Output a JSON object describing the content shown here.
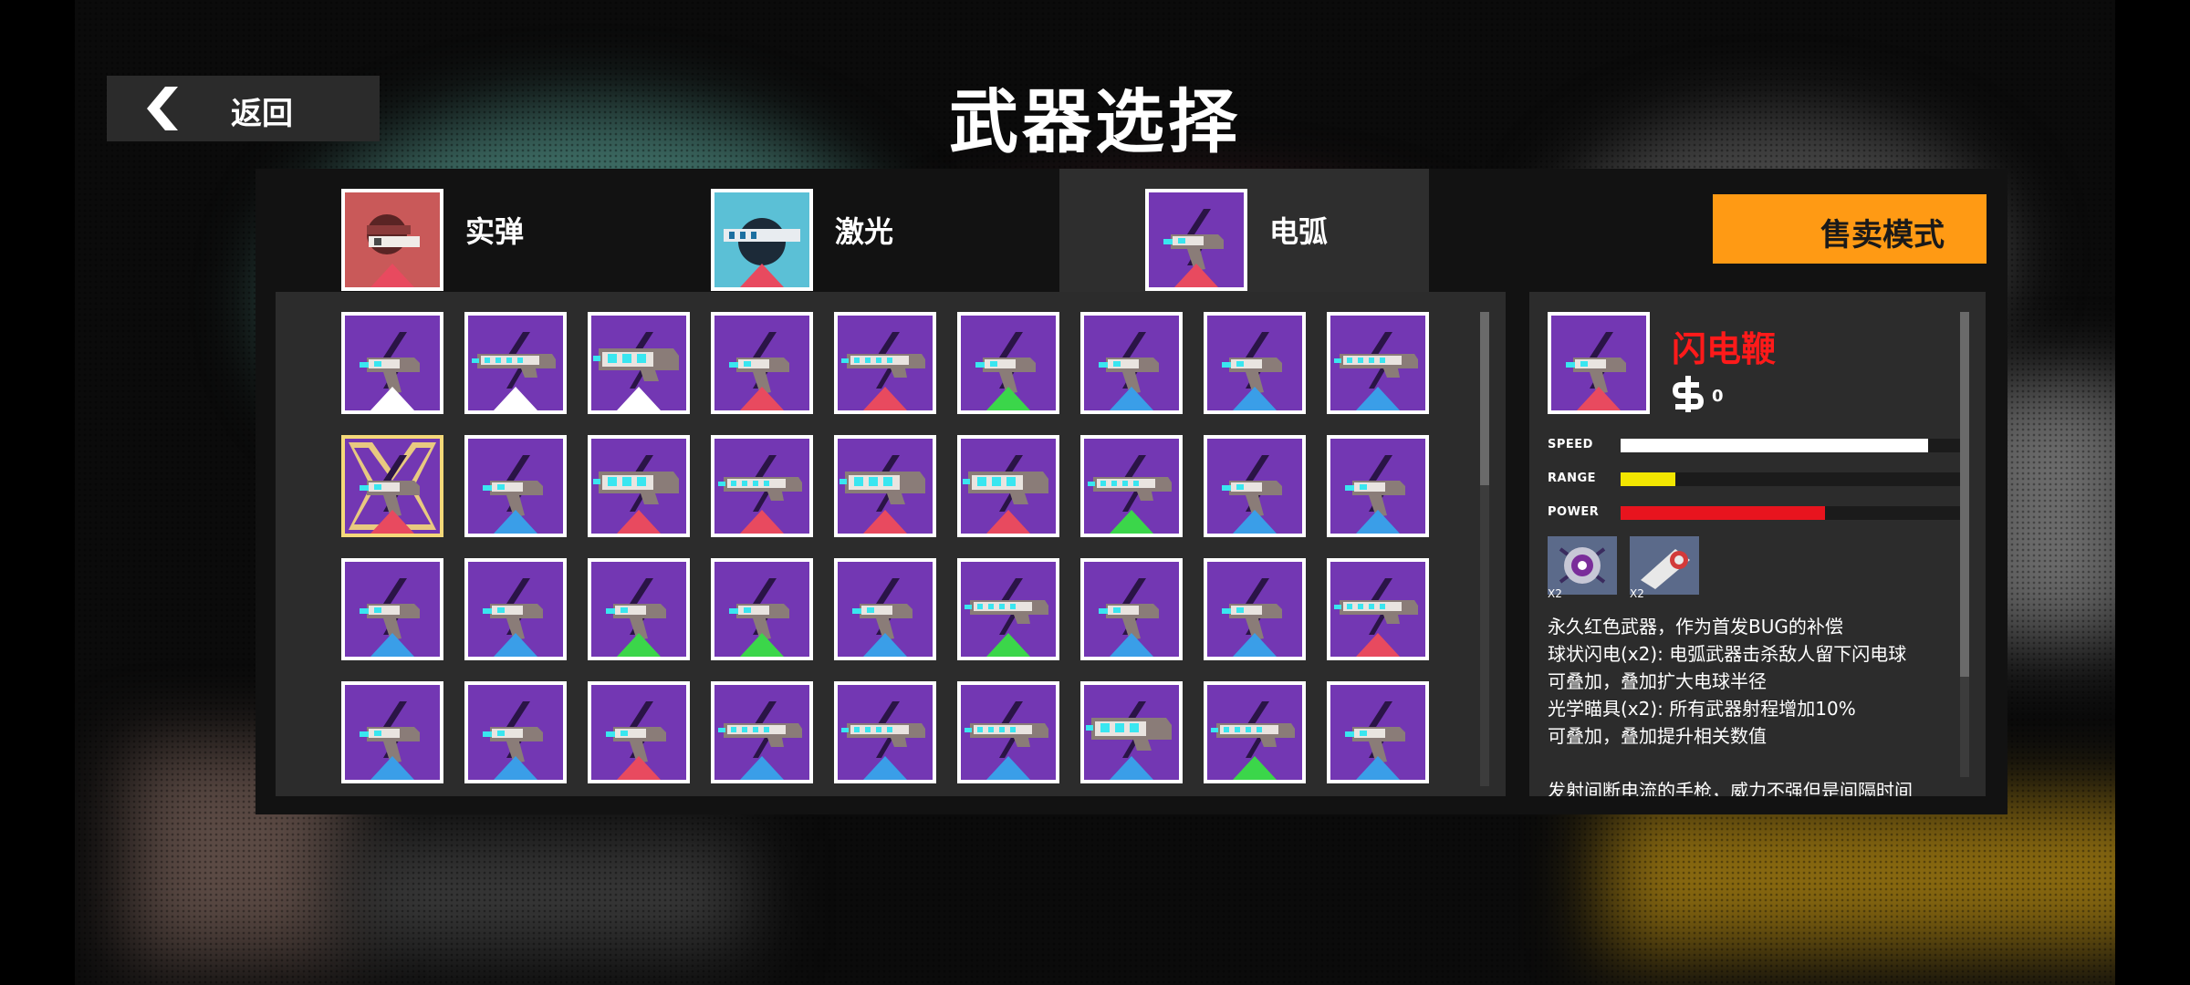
{
  "colors": {
    "tile_bg": "#7337b3",
    "tile_border": "#ffffff",
    "selected_border": "#f5d97a",
    "rarity_white": "#ffffff",
    "rarity_red": "#e84a5f",
    "rarity_green": "#3bd64a",
    "rarity_blue": "#3a9ee8",
    "sell_button": "#ff9a14",
    "name_red": "#ff1a1a",
    "speed_bar": "#ffffff",
    "range_bar": "#f2e600",
    "power_bar": "#e8141e"
  },
  "header": {
    "back_label": "返回",
    "back_icon": "chevron-left-icon",
    "title": "武器选择"
  },
  "tabs": [
    {
      "label": "实弹",
      "icon": "ballistic-gun-icon",
      "bg": "#c95959",
      "rarity": "red",
      "selected": false
    },
    {
      "label": "激光",
      "icon": "laser-gun-icon",
      "bg": "#5bc0d6",
      "rarity": "red",
      "selected": false
    },
    {
      "label": "电弧",
      "icon": "arc-gun-icon",
      "bg": "#7337b3",
      "rarity": "red",
      "selected": true
    }
  ],
  "sell_button": {
    "label": "售卖模式"
  },
  "weapons": [
    [
      {
        "k": "pistol",
        "r": "white"
      },
      {
        "k": "rifle",
        "r": "white"
      },
      {
        "k": "cannon",
        "r": "white"
      },
      {
        "k": "pistol",
        "r": "red"
      },
      {
        "k": "rifle",
        "r": "red"
      },
      {
        "k": "pistol",
        "r": "green"
      },
      {
        "k": "pistol",
        "r": "blue"
      },
      {
        "k": "pistol",
        "r": "blue"
      },
      {
        "k": "rifle",
        "r": "blue"
      }
    ],
    [
      {
        "k": "pistol",
        "r": "red",
        "sel": true
      },
      {
        "k": "pistol",
        "r": "blue"
      },
      {
        "k": "cannon",
        "r": "red"
      },
      {
        "k": "rifle",
        "r": "red"
      },
      {
        "k": "cannon",
        "r": "red"
      },
      {
        "k": "cannon",
        "r": "red"
      },
      {
        "k": "rifle",
        "r": "green"
      },
      {
        "k": "pistol",
        "r": "blue"
      },
      {
        "k": "pistol",
        "r": "blue"
      }
    ],
    [
      {
        "k": "pistol",
        "r": "blue"
      },
      {
        "k": "pistol",
        "r": "blue"
      },
      {
        "k": "pistol",
        "r": "green"
      },
      {
        "k": "pistol",
        "r": "green"
      },
      {
        "k": "pistol",
        "r": "blue"
      },
      {
        "k": "rifle",
        "r": "green"
      },
      {
        "k": "pistol",
        "r": "blue"
      },
      {
        "k": "pistol",
        "r": "blue"
      },
      {
        "k": "rifle",
        "r": "red"
      }
    ],
    [
      {
        "k": "pistol",
        "r": "blue"
      },
      {
        "k": "pistol",
        "r": "blue"
      },
      {
        "k": "pistol",
        "r": "red"
      },
      {
        "k": "rifle",
        "r": "blue"
      },
      {
        "k": "rifle",
        "r": "blue"
      },
      {
        "k": "rifle",
        "r": "blue"
      },
      {
        "k": "cannon",
        "r": "blue"
      },
      {
        "k": "rifle",
        "r": "green"
      },
      {
        "k": "pistol",
        "r": "blue"
      }
    ]
  ],
  "detail": {
    "name": "闪电鞭",
    "price": "0",
    "stats": [
      {
        "label": "SPEED",
        "value": 0.9,
        "color": "#ffffff"
      },
      {
        "label": "RANGE",
        "value": 0.16,
        "color": "#f2e600"
      },
      {
        "label": "POWER",
        "value": 0.6,
        "color": "#e8141e"
      }
    ],
    "mods": [
      {
        "icon": "ball-lightning-icon",
        "count": "X2"
      },
      {
        "icon": "optical-scope-icon",
        "count": "X2"
      }
    ],
    "description": [
      "永久红色武器，作为首发BUG的补偿",
      "球状闪电(x2): 电弧武器击杀敌人留下闪电球",
      "可叠加，叠加扩大电球半径",
      "光学瞄具(x2): 所有武器射程增加10%",
      "可叠加，叠加提升相关数值",
      "",
      "发射间断电流的手枪，威力不强但是间隔时间"
    ]
  }
}
